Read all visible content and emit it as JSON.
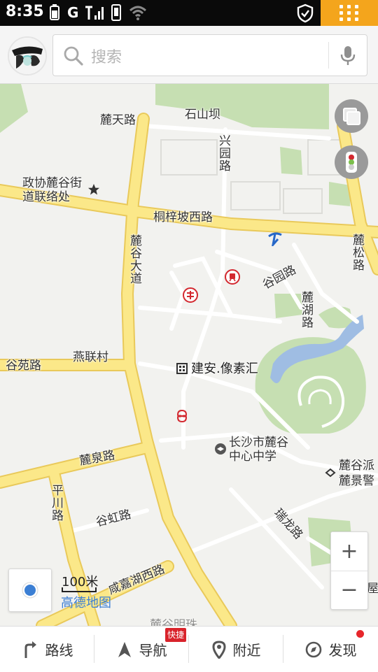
{
  "status_bar": {
    "time": "8:35",
    "network": "G",
    "icons": [
      "battery-icon",
      "signal-icon",
      "phone-icon",
      "wifi-icon",
      "shield-icon",
      "app-grid-icon"
    ]
  },
  "search": {
    "placeholder": "搜索",
    "icons": [
      "search-icon",
      "microphone-icon"
    ]
  },
  "map": {
    "road_labels": {
      "lugu_tian_lu": "麓天路",
      "shishan_ba": "石山坝",
      "xingyuan_lu": "兴园路",
      "zhengxie": "政协麓谷街\n道联络处",
      "tongzipo_xilu": "桐梓坡西路",
      "lusong_lu": "麓松路",
      "lugu_dadao": "麓谷大道",
      "guyuan_lu_right": "谷园路",
      "luhu_lu": "麓湖路",
      "guyuan_lu_left": "谷苑路",
      "yanlian_cun": "燕联村",
      "jianan": "建安.像素汇",
      "lugu_zhongxue": "长沙市麓谷\n中心中学",
      "luquan_lu": "麓泉路",
      "lugu_pai": "麓谷派",
      "lujing_jing": "麓景警",
      "pingchuan_lu": "平川路",
      "guhong_lu": "谷虹路",
      "ruilong_lu": "瑞龙路",
      "xianjiahu_xilu": "咸嘉湖西路",
      "bottom_partial": "麓谷明珠",
      "right_partial": "屋"
    },
    "scale_label": "100米",
    "brand": "高德地图"
  },
  "controls": {
    "zoom_in": "+",
    "zoom_out": "−"
  },
  "tabs": [
    {
      "label": "路线",
      "icon": "route-icon"
    },
    {
      "label": "导航",
      "icon": "navigation-arrow-icon"
    },
    {
      "label": "附近",
      "icon": "location-pin-icon"
    },
    {
      "label": "发现",
      "icon": "discover-icon"
    }
  ],
  "badge": "快捷",
  "colors": {
    "road_major": "#fbe889",
    "road_border": "#e9c95a",
    "park": "#c6dfb2",
    "water": "#9fbde3",
    "accent": "#3c7fd4",
    "statusbar_app": "#f4a51c"
  }
}
